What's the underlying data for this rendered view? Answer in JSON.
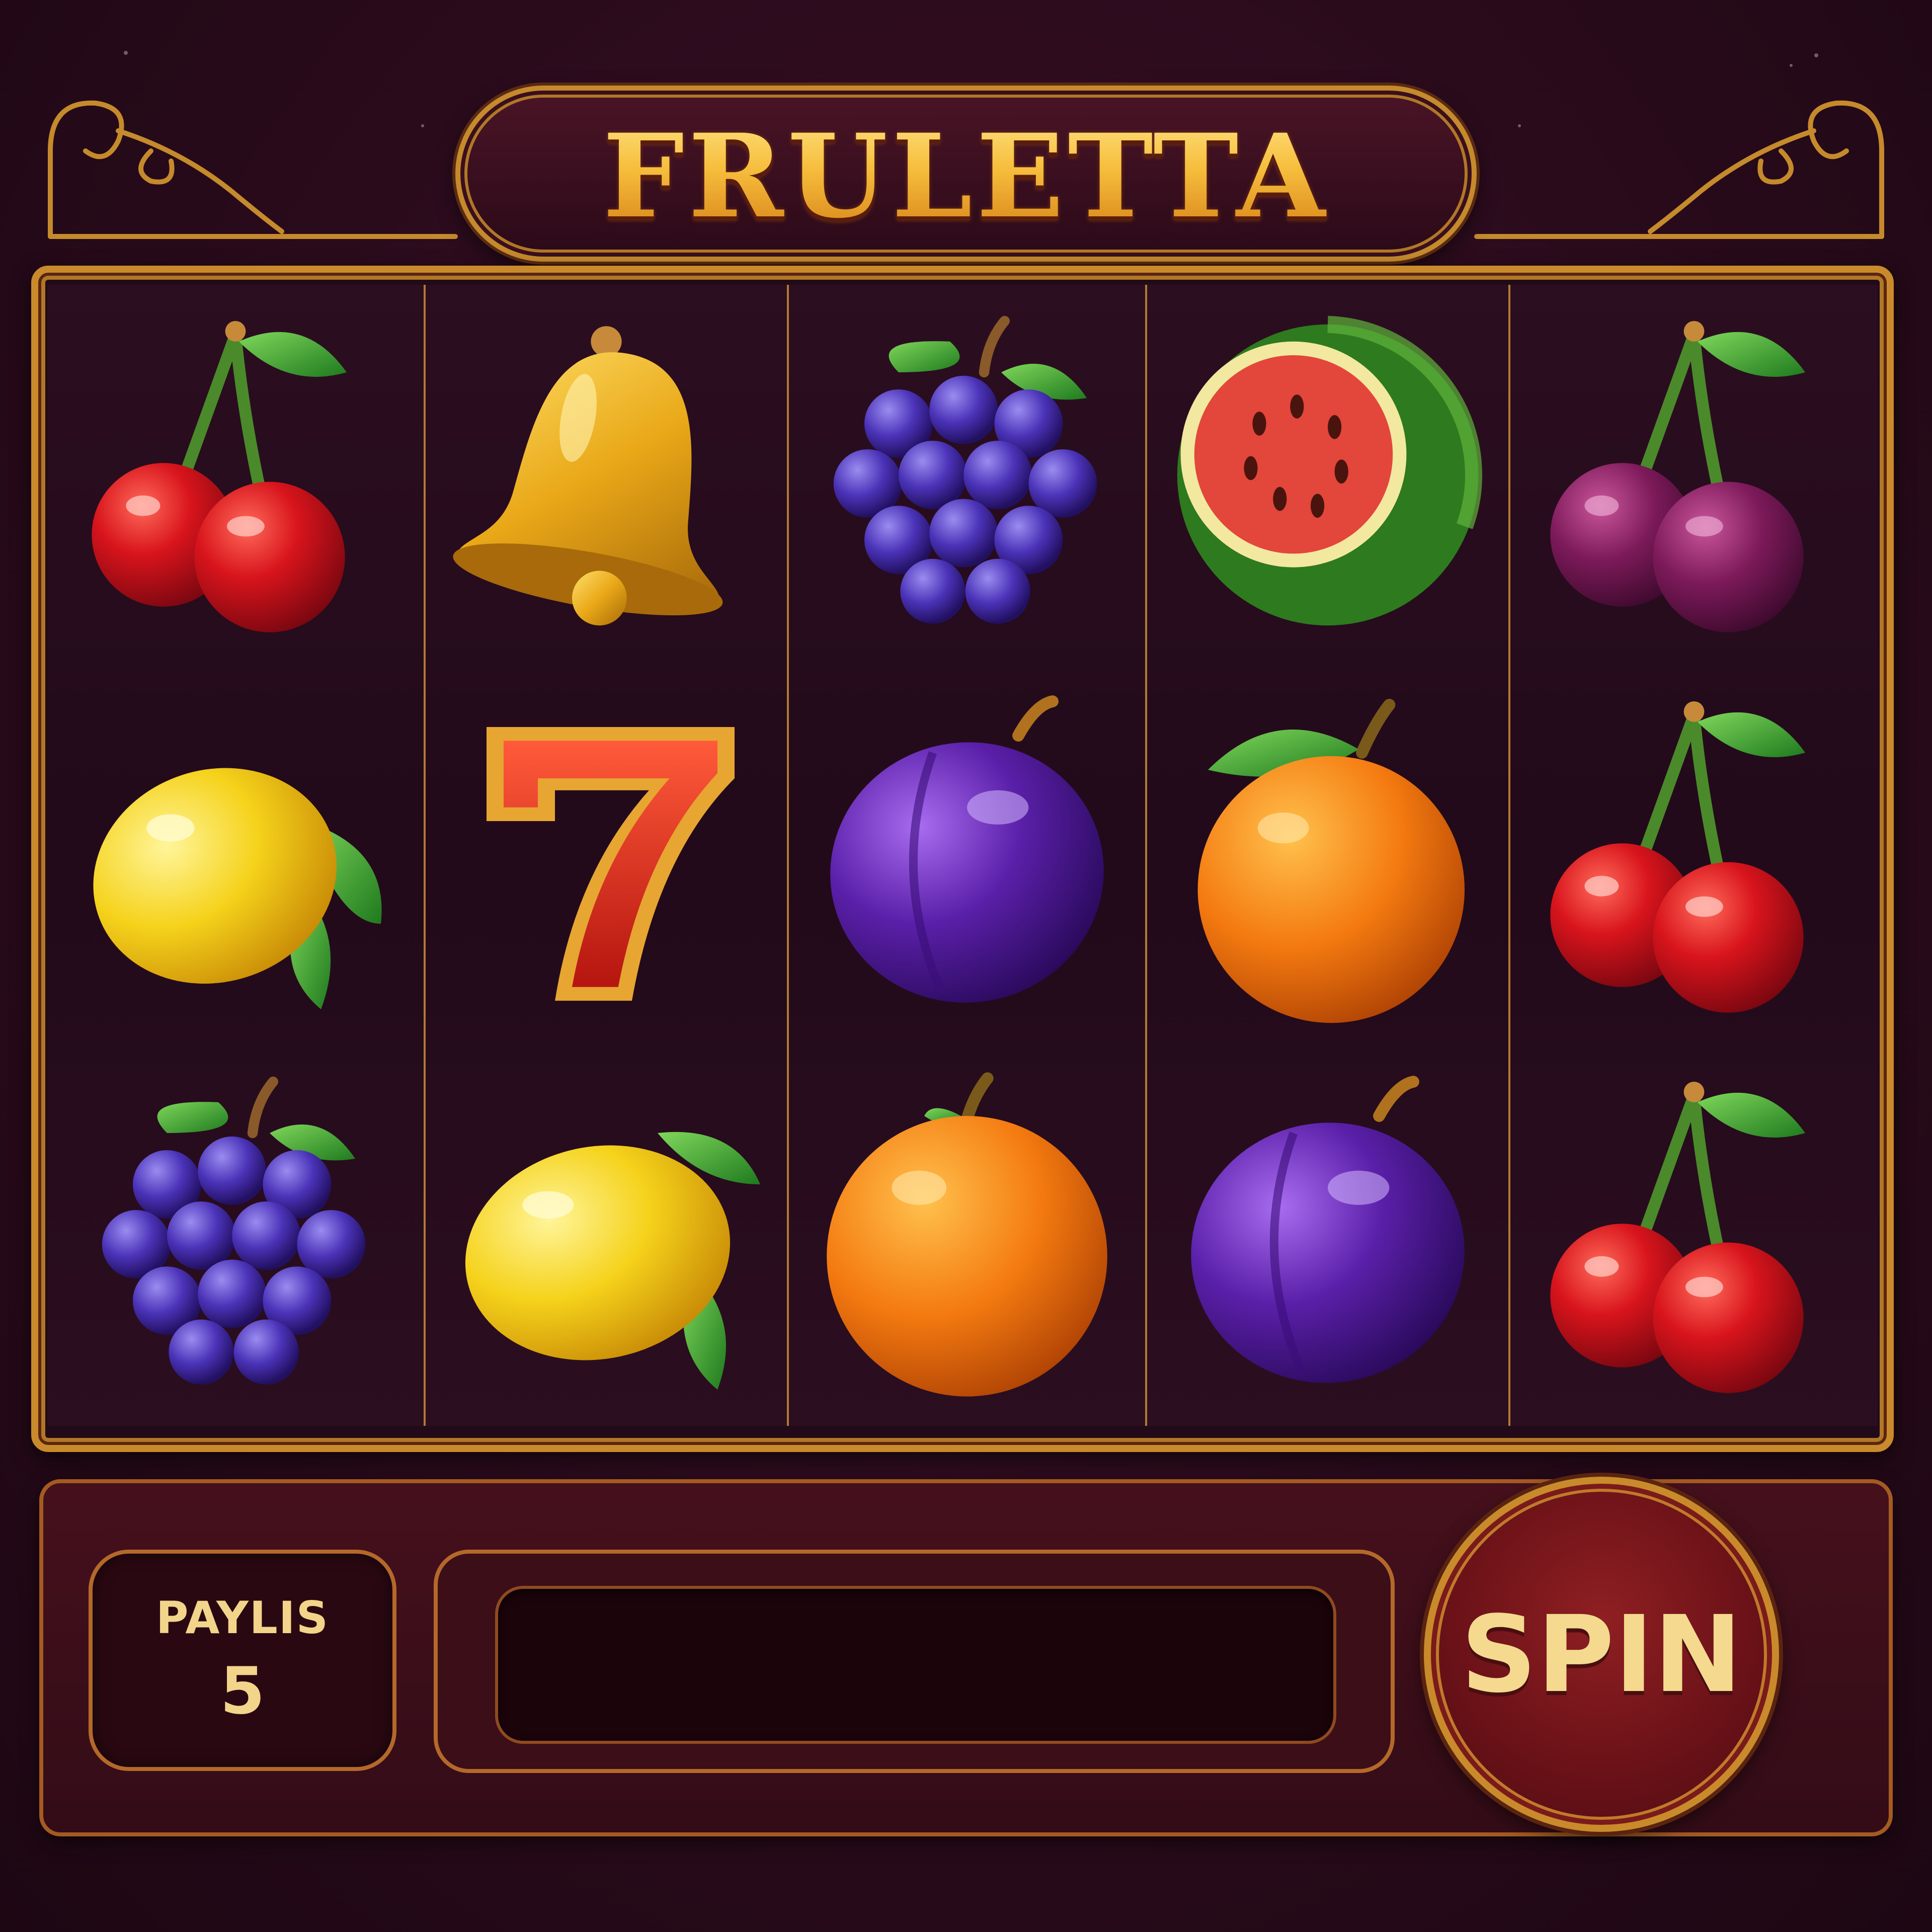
{
  "game": {
    "title": "FRULETTA"
  },
  "reels": [
    [
      "cherry",
      "lemon",
      "grapes"
    ],
    [
      "bell",
      "seven",
      "lemon"
    ],
    [
      "grapes",
      "plum",
      "orange"
    ],
    [
      "watermelon",
      "orange",
      "plum"
    ],
    [
      "plum-cherry",
      "cherry",
      "cherry"
    ]
  ],
  "controls": {
    "paylines_label": "PAYLIS",
    "paylines_value": "5",
    "spin_label": "SPIN"
  },
  "colors": {
    "background": "#2a0b1c",
    "gold": "#c98a2b",
    "title_gold": "#f6bd3c",
    "spin_red": "#6b1218",
    "label_cream": "#f2d58a"
  }
}
